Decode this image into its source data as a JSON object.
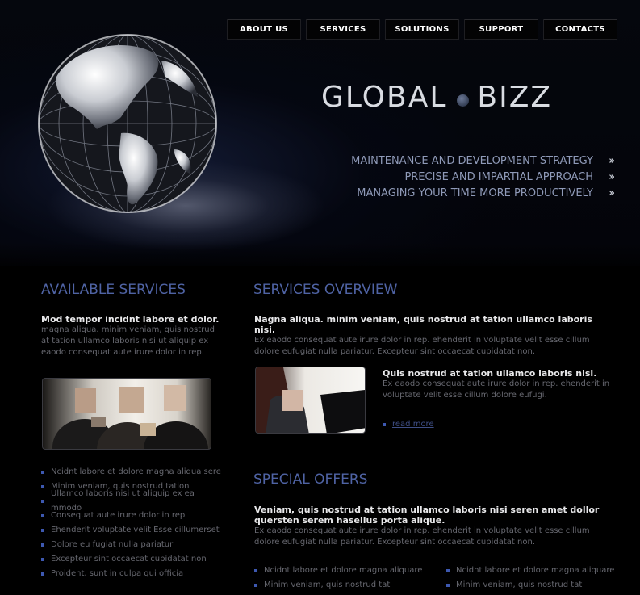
{
  "nav": {
    "items": [
      {
        "label": "ABOUT US"
      },
      {
        "label": "SERVICES"
      },
      {
        "label": "SOLUTIONS"
      },
      {
        "label": "SUPPORT"
      },
      {
        "label": "CONTACTS"
      }
    ]
  },
  "logo": {
    "left": "GLOBAL",
    "right": "BIZZ"
  },
  "taglines": [
    "MAINTENANCE AND DEVELOPMENT STRATEGY",
    "PRECISE AND IMPARTIAL APPROACH",
    "MANAGING YOUR TIME MORE PRODUCTIVELY"
  ],
  "available": {
    "title": "AVAILABLE SERVICES",
    "lead": "Mod tempor incidnt labore et dolor.",
    "text": "magna aliqua. minim veniam, quis nostrud at tation ullamco laboris nisi ut aliquip ex eaodo consequat aute irure dolor in rep.",
    "items": [
      "Ncidnt labore et dolore magna aliqua sere",
      "Minim veniam, quis nostrud tation",
      "Ullamco laboris nisi ut aliquip ex ea mmodo",
      "Consequat aute irure  dolor in rep",
      "Ehenderit voluptate velit Esse cillumerset",
      "Dolore eu fugiat nulla pariatur",
      "Excepteur sint occaecat cupidatat non",
      "Proident, sunt in culpa qui officia"
    ]
  },
  "overview": {
    "title": "SERVICES OVERVIEW",
    "lead": "Nagna aliqua. minim veniam, quis nostrud at tation ullamco laboris nisi.",
    "text": "Ex eaodo consequat aute irure dolor in rep. ehenderit in voluptate velit esse cillum dolore eufugiat nulla pariatur. Excepteur sint occaecat cupidatat non.",
    "feature_lead": "Quis nostrud at tation ullamco laboris nisi.",
    "feature_text": "Ex eaodo consequat aute irure dolor in rep. ehenderit in voluptate velit esse cillum dolore eufugi.",
    "read_more": "read more"
  },
  "offers": {
    "title": "SPECIAL OFFERS",
    "lead": "Veniam, quis nostrud at tation ullamco laboris nisi seren amet dollor quersten serem hasellus porta alique.",
    "text": "Ex eaodo consequat aute irure dolor in rep. ehenderit in voluptate velit esse cillum dolore eufugiat nulla pariatur. Excepteur sint occaecat cupidatat non.",
    "col1": [
      "Ncidnt labore et dolore magna aliquare",
      "Minim veniam, quis nostrud tat"
    ],
    "col2": [
      "Ncidnt labore et dolore magna aliquare",
      "Minim veniam, quis nostrud tat"
    ]
  }
}
